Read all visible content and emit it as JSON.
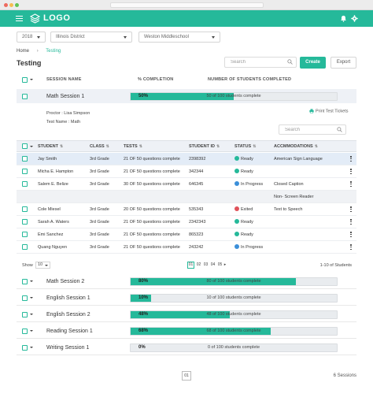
{
  "header": {
    "logo_text": "LOGO",
    "accent_color": "#25b99a"
  },
  "filters": {
    "year": "2018",
    "district": "Illinois District",
    "school": "Weston Middleschool"
  },
  "breadcrumb": {
    "home": "Home",
    "current": "Testing"
  },
  "page": {
    "title": "Testing"
  },
  "toolbar": {
    "search_placeholder": "Search",
    "create_label": "Create",
    "export_label": "Export"
  },
  "sessions_table": {
    "columns": [
      "SESSION NAME",
      "% COMPLETION",
      "NUMBER OF STUDENTS COMPLETED"
    ]
  },
  "sessions": [
    {
      "name": "Math Session 1",
      "percent_label": "50%",
      "progress": 0.5,
      "completed_text": "50 of 100 students complete"
    },
    {
      "name": "Math Session 2",
      "percent_label": "80%",
      "progress": 0.8,
      "completed_text": "80 of 100 students complete"
    },
    {
      "name": "English Session 1",
      "percent_label": "10%",
      "progress": 0.1,
      "completed_text": "10 of 100 students complete"
    },
    {
      "name": "English Session 2",
      "percent_label": "48%",
      "progress": 0.48,
      "completed_text": "48 of 100 students complete"
    },
    {
      "name": "Reading Session 1",
      "percent_label": "68%",
      "progress": 0.68,
      "completed_text": "68 of 100 students complete"
    },
    {
      "name": "Writing Session 1",
      "percent_label": "0%",
      "progress": 0.0,
      "completed_text": "0 of 100 students complete"
    }
  ],
  "detail": {
    "proctor": "Proctor : Lisa Simpson",
    "test_name": "Test Name : Math",
    "print_label": "Print Test Tickets",
    "search_placeholder": "Search",
    "columns": [
      "STUDENT",
      "CLASS",
      "TESTS",
      "STUDENT ID",
      "STATUS",
      "ACCMMODATIONS"
    ],
    "students": [
      {
        "name": "Jay Smith",
        "class": "3rd Grade",
        "tests": "21 OF 50 questions complete",
        "id": "2398392",
        "status": "Ready",
        "status_color": "#25b99a",
        "accommodation": "American Sign Language"
      },
      {
        "name": "Micha E. Hampton",
        "class": "3rd Grade",
        "tests": "21 OF 50 questions complete",
        "id": "342344",
        "status": "Ready",
        "status_color": "#25b99a",
        "accommodation": ""
      },
      {
        "name": "Salem E. Belize",
        "class": "3rd Grade",
        "tests": "30 OF 50 questions complete",
        "id": "646345",
        "status": "In Progress",
        "status_color": "#3b8fd9",
        "accommodation": "Closed Caption"
      },
      {
        "name": "",
        "class": "",
        "tests": "",
        "id": "",
        "status": "",
        "status_color": "",
        "accommodation": "Non- Screen Reader"
      },
      {
        "name": "Cole Miesel",
        "class": "3rd Grade",
        "tests": "20 OF 50 questions complete",
        "id": "535343",
        "status": "Exited",
        "status_color": "#e0525a",
        "accommodation": "Text to Speech"
      },
      {
        "name": "Sarah A. Waters",
        "class": "3rd Grade",
        "tests": "21 OF 50 questions complete",
        "id": "2342343",
        "status": "Ready",
        "status_color": "#25b99a",
        "accommodation": ""
      },
      {
        "name": "Emi Sanchez",
        "class": "3rd Grade",
        "tests": "21 OF 50 questions complete",
        "id": "865323",
        "status": "Ready",
        "status_color": "#25b99a",
        "accommodation": ""
      },
      {
        "name": "Quang Nguyen",
        "class": "3rd Grade",
        "tests": "21 OF 50 questions complete",
        "id": "243242",
        "status": "In Progress",
        "status_color": "#3b8fd9",
        "accommodation": ""
      }
    ],
    "pager": {
      "show_label": "Show",
      "show_value": "10",
      "pages": [
        "01",
        "02",
        "03",
        "04",
        "05"
      ],
      "next_label": "▸",
      "range": "1-10  of Students"
    }
  },
  "footer": {
    "page": "01",
    "count": "6 Sessions"
  }
}
